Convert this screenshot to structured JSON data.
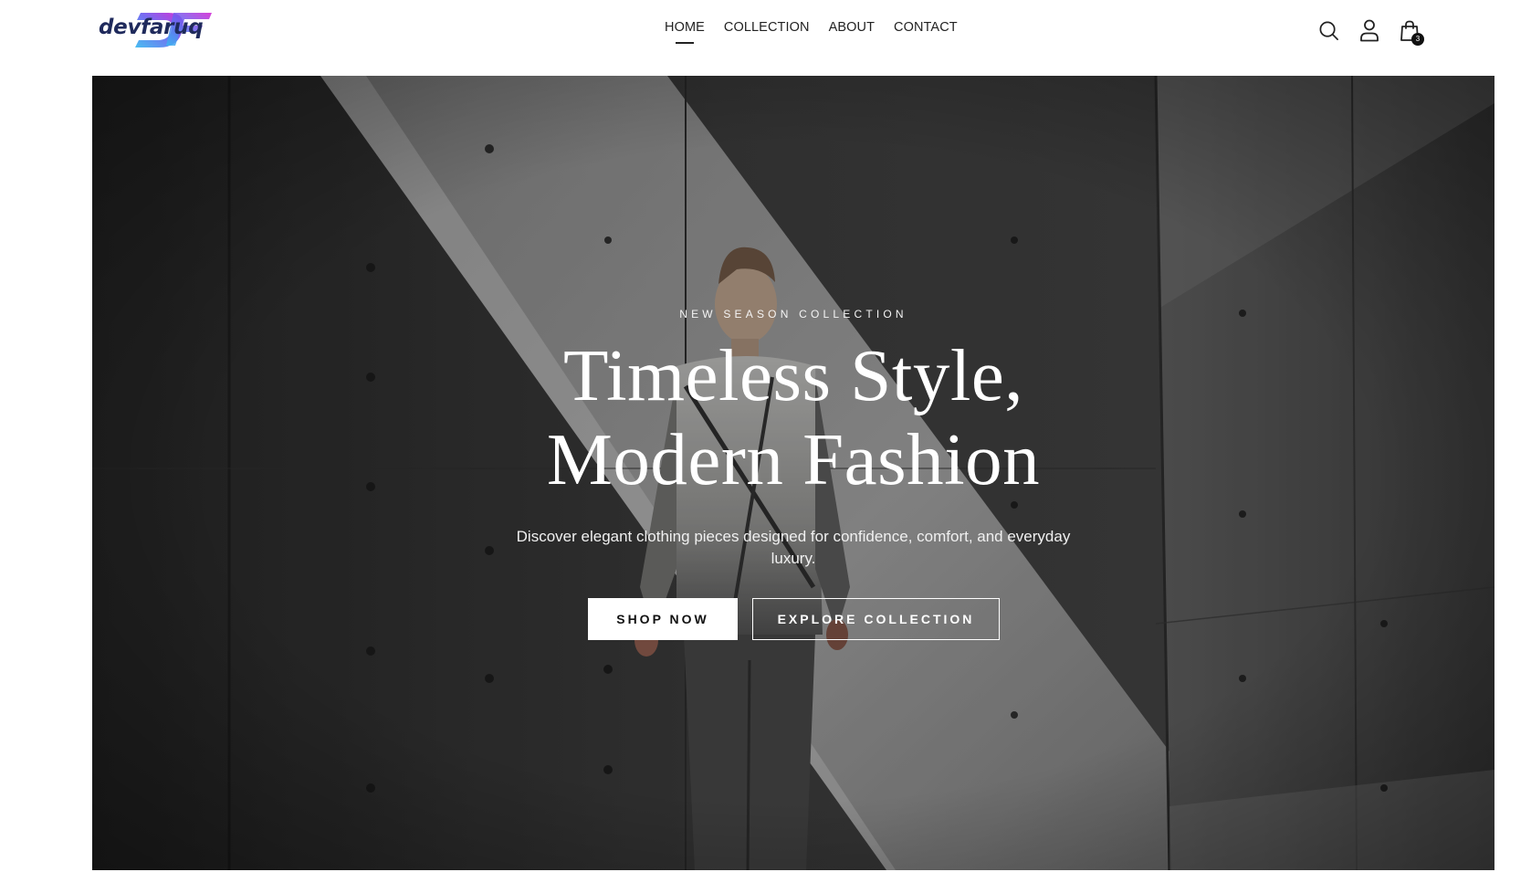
{
  "brand": {
    "logo_text": "devfaruq",
    "colors": {
      "logo_text": "#1f2a5c",
      "logo_gradient_start": "#39b8f0",
      "logo_gradient_end": "#d21fd2"
    }
  },
  "nav": {
    "items": [
      {
        "label": "HOME",
        "active": true
      },
      {
        "label": "COLLECTION",
        "active": false
      },
      {
        "label": "ABOUT",
        "active": false
      },
      {
        "label": "CONTACT",
        "active": false
      }
    ]
  },
  "header_icons": {
    "search": "search-icon",
    "account": "user-icon",
    "cart": "shopping-bag-icon",
    "cart_count": "3"
  },
  "hero": {
    "eyebrow": "NEW SEASON COLLECTION",
    "title_line_1": "Timeless Style,",
    "title_line_2": "Modern Fashion",
    "subtitle": "Discover elegant clothing pieces designed for confidence, comfort, and everyday luxury.",
    "primary_button": "SHOP NOW",
    "secondary_button": "EXPLORE COLLECTION"
  }
}
